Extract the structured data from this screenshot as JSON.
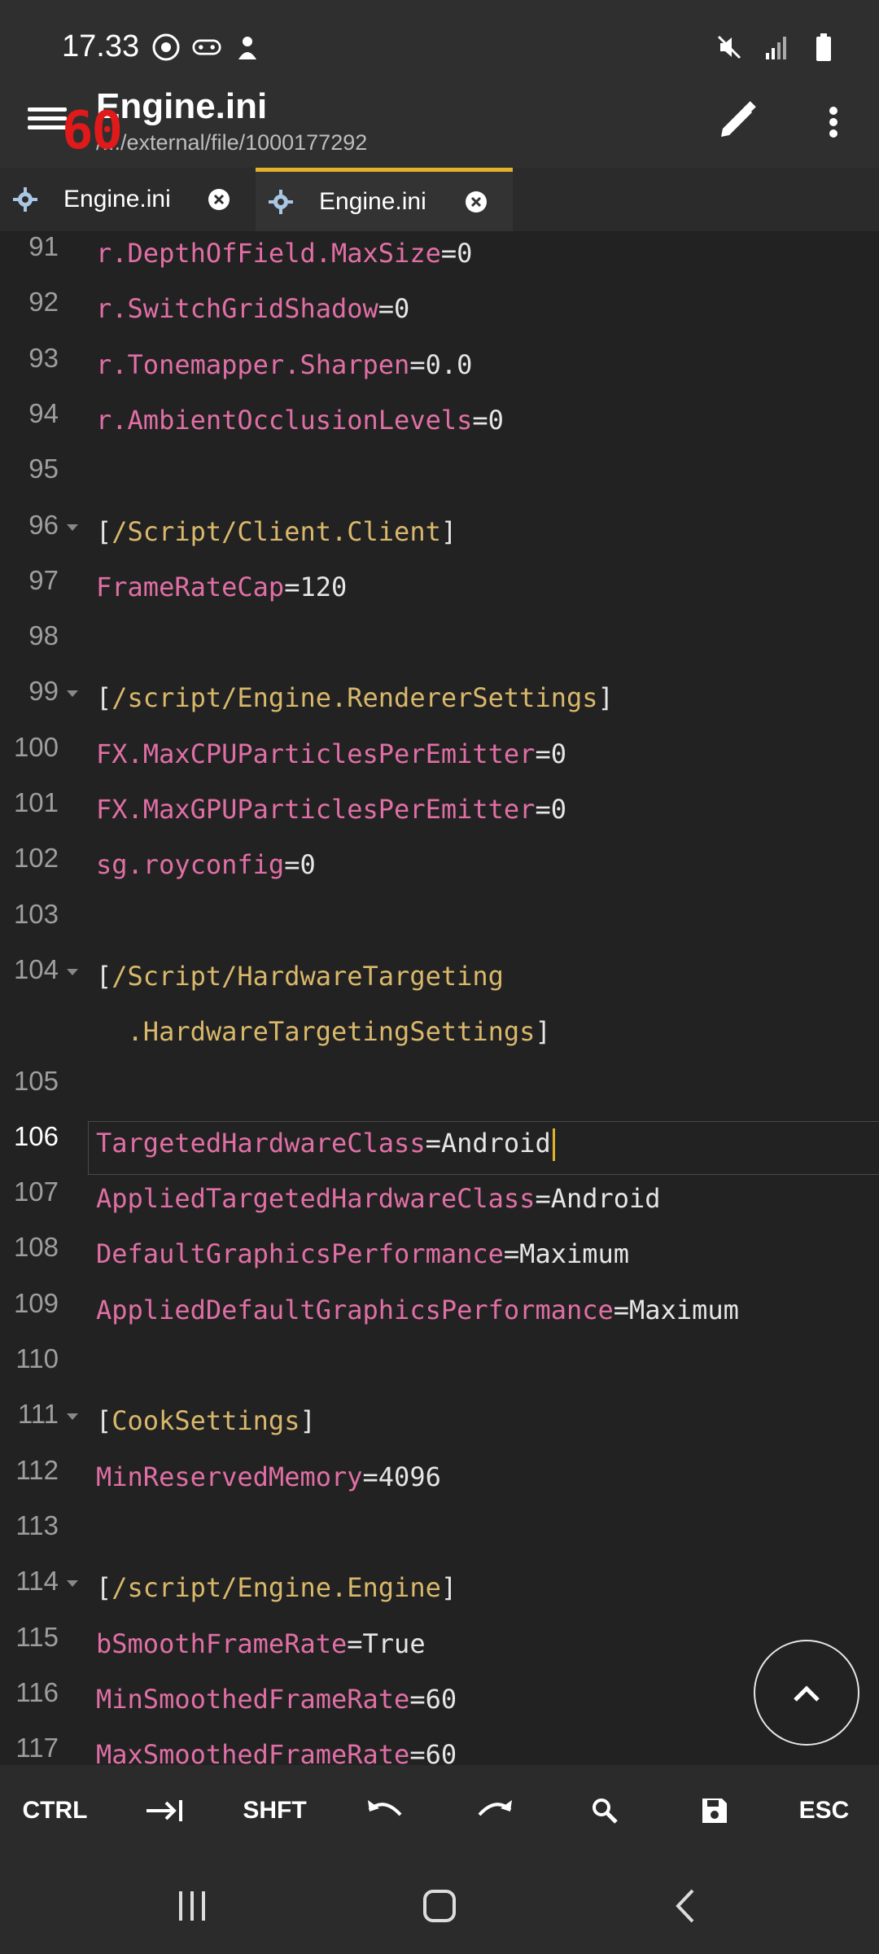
{
  "status_bar": {
    "time": "17.33",
    "left_icons": [
      "chrome-icon",
      "gamepad-icon",
      "game-booster-icon"
    ],
    "right_icons": [
      "mute-icon",
      "signal-icon",
      "battery-icon"
    ]
  },
  "app_bar": {
    "title": "Engine.ini",
    "subtitle": "/.../external/file/1000177292",
    "fps_overlay": "60"
  },
  "tabs": [
    {
      "label": "Engine.ini",
      "active": false
    },
    {
      "label": "Engine.ini",
      "active": true
    }
  ],
  "editor": {
    "current_line": 106,
    "lines": [
      {
        "num": "91",
        "fold": false,
        "parts": [
          [
            "k",
            "r.DepthOfField.MaxSize"
          ],
          [
            "p",
            "="
          ],
          [
            "v",
            "0"
          ]
        ]
      },
      {
        "num": "92",
        "fold": false,
        "parts": [
          [
            "k",
            "r.SwitchGridShadow"
          ],
          [
            "p",
            "="
          ],
          [
            "v",
            "0"
          ]
        ]
      },
      {
        "num": "93",
        "fold": false,
        "parts": [
          [
            "k",
            "r.Tonemapper.Sharpen"
          ],
          [
            "p",
            "="
          ],
          [
            "v",
            "0.0"
          ]
        ]
      },
      {
        "num": "94",
        "fold": false,
        "parts": [
          [
            "k",
            "r.AmbientOcclusionLevels"
          ],
          [
            "p",
            "="
          ],
          [
            "v",
            "0"
          ]
        ]
      },
      {
        "num": "95",
        "fold": false,
        "parts": []
      },
      {
        "num": "96",
        "fold": true,
        "parts": [
          [
            "p",
            "["
          ],
          [
            "s",
            "/Script/Client.Client"
          ],
          [
            "p",
            "]"
          ]
        ]
      },
      {
        "num": "97",
        "fold": false,
        "parts": [
          [
            "k",
            "FrameRateCap"
          ],
          [
            "p",
            "="
          ],
          [
            "v",
            "120"
          ]
        ]
      },
      {
        "num": "98",
        "fold": false,
        "parts": []
      },
      {
        "num": "99",
        "fold": true,
        "parts": [
          [
            "p",
            "["
          ],
          [
            "s",
            "/script/Engine.RendererSettings"
          ],
          [
            "p",
            "]"
          ]
        ]
      },
      {
        "num": "100",
        "fold": false,
        "parts": [
          [
            "k",
            "FX.MaxCPUParticlesPerEmitter"
          ],
          [
            "p",
            "="
          ],
          [
            "v",
            "0"
          ]
        ]
      },
      {
        "num": "101",
        "fold": false,
        "parts": [
          [
            "k",
            "FX.MaxGPUParticlesPerEmitter"
          ],
          [
            "p",
            "="
          ],
          [
            "v",
            "0"
          ]
        ]
      },
      {
        "num": "102",
        "fold": false,
        "parts": [
          [
            "k",
            "sg.royconfig"
          ],
          [
            "p",
            "="
          ],
          [
            "v",
            "0"
          ]
        ]
      },
      {
        "num": "103",
        "fold": false,
        "parts": []
      },
      {
        "num": "104",
        "fold": true,
        "parts": [
          [
            "p",
            "["
          ],
          [
            "s",
            "/Script/HardwareTargeting"
          ]
        ]
      },
      {
        "num": "",
        "fold": false,
        "parts": [
          [
            "s",
            "  .HardwareTargetingSettings"
          ],
          [
            "p",
            "]"
          ]
        ]
      },
      {
        "num": "105",
        "fold": false,
        "parts": []
      },
      {
        "num": "106",
        "fold": false,
        "cursor": true,
        "parts": [
          [
            "k",
            "TargetedHardwareClass"
          ],
          [
            "p",
            "="
          ],
          [
            "v",
            "Android"
          ]
        ]
      },
      {
        "num": "107",
        "fold": false,
        "parts": [
          [
            "k",
            "AppliedTargetedHardwareClass"
          ],
          [
            "p",
            "="
          ],
          [
            "v",
            "Android"
          ]
        ]
      },
      {
        "num": "108",
        "fold": false,
        "parts": [
          [
            "k",
            "DefaultGraphicsPerformance"
          ],
          [
            "p",
            "="
          ],
          [
            "v",
            "Maximum"
          ]
        ]
      },
      {
        "num": "109",
        "fold": false,
        "parts": [
          [
            "k",
            "AppliedDefaultGraphicsPerformance"
          ],
          [
            "p",
            "="
          ],
          [
            "v",
            "Maximum"
          ]
        ]
      },
      {
        "num": "110",
        "fold": false,
        "parts": []
      },
      {
        "num": "111",
        "fold": true,
        "parts": [
          [
            "p",
            "["
          ],
          [
            "s",
            "CookSettings"
          ],
          [
            "p",
            "]"
          ]
        ]
      },
      {
        "num": "112",
        "fold": false,
        "parts": [
          [
            "k",
            "MinReservedMemory"
          ],
          [
            "p",
            "="
          ],
          [
            "v",
            "4096"
          ]
        ]
      },
      {
        "num": "113",
        "fold": false,
        "parts": []
      },
      {
        "num": "114",
        "fold": true,
        "parts": [
          [
            "p",
            "["
          ],
          [
            "s",
            "/script/Engine.Engine"
          ],
          [
            "p",
            "]"
          ]
        ]
      },
      {
        "num": "115",
        "fold": false,
        "parts": [
          [
            "k",
            "bSmoothFrameRate"
          ],
          [
            "p",
            "="
          ],
          [
            "v",
            "True"
          ]
        ]
      },
      {
        "num": "116",
        "fold": false,
        "parts": [
          [
            "k",
            "MinSmoothedFrameRate"
          ],
          [
            "p",
            "="
          ],
          [
            "v",
            "60"
          ]
        ]
      },
      {
        "num": "117",
        "fold": false,
        "parts": [
          [
            "k",
            "MaxSmoothedFrameRate"
          ],
          [
            "p",
            "="
          ],
          [
            "v",
            "60"
          ]
        ]
      }
    ]
  },
  "scroll_top_button": "chevron-up-icon",
  "extra_keys": [
    {
      "label": "CTRL",
      "icon": ""
    },
    {
      "label": "",
      "icon": "tab-icon"
    },
    {
      "label": "SHFT",
      "icon": ""
    },
    {
      "label": "",
      "icon": "undo-icon"
    },
    {
      "label": "",
      "icon": "redo-icon"
    },
    {
      "label": "",
      "icon": "search-icon"
    },
    {
      "label": "",
      "icon": "save-icon"
    },
    {
      "label": "ESC",
      "icon": ""
    }
  ],
  "nav_bar": [
    "recents-icon",
    "home-icon",
    "back-icon"
  ],
  "colors": {
    "background": "#222222",
    "key": "#e06fa6",
    "section": "#d9b86b",
    "accent": "#e2b22a"
  }
}
